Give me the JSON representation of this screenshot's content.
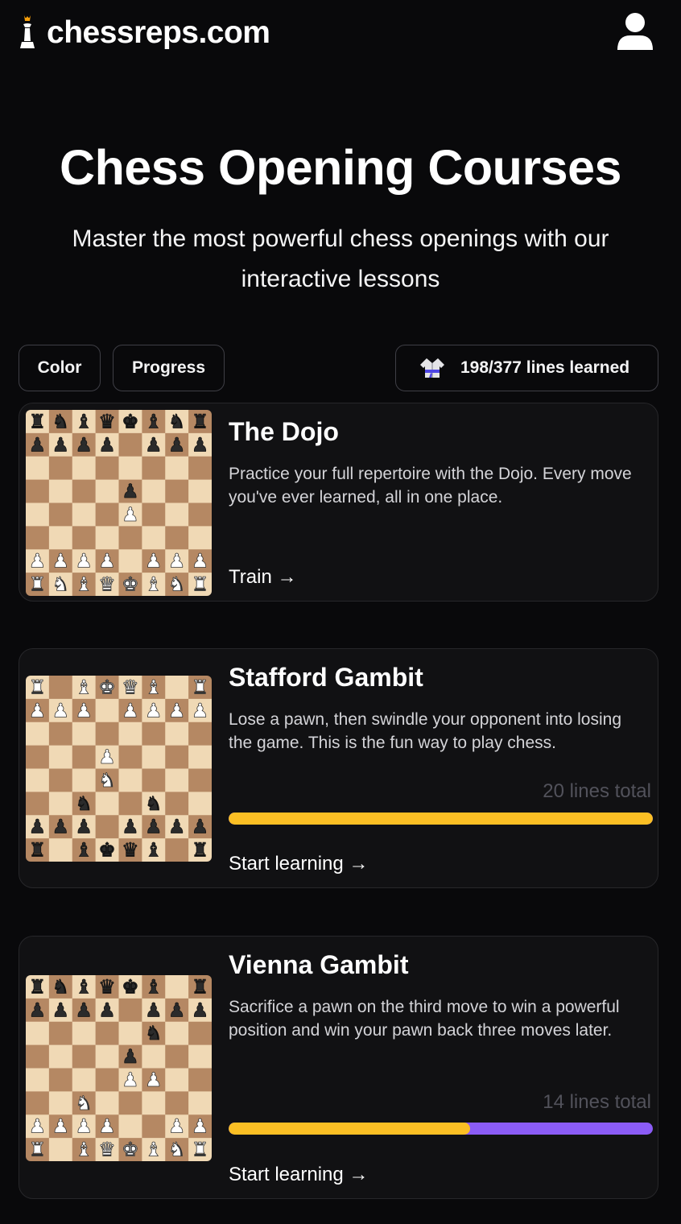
{
  "header": {
    "site_name": "chessreps.com",
    "logo_icon": "chess-king-icon",
    "user_icon": "user-icon"
  },
  "hero": {
    "title": "Chess Opening Courses",
    "subtitle": "Master the most powerful chess openings with our interactive lessons"
  },
  "filters": {
    "color_label": "Color",
    "progress_label": "Progress",
    "stats_icon": "karate-gi-icon",
    "stats_label": "198/377 lines learned"
  },
  "colors": {
    "background": "#09090b",
    "card": "#111113",
    "progress_learned": "#fbbf24",
    "progress_remaining": "#8b5cf6",
    "arrow": "#6d5acf"
  },
  "courses": [
    {
      "title": "The Dojo",
      "description": "Practice your full repertoire with the Dojo. Every move you've ever learned, all in one place.",
      "cta": "Train →",
      "board": [
        "rnbqkbnr",
        "pppp.ppp",
        "........",
        "....p...",
        "....P...",
        "........",
        "PPPP.PPP",
        "RNBQKBNR"
      ]
    },
    {
      "title": "Stafford Gambit",
      "description": "Lose a pawn, then swindle your opponent into losing the game. This is the fun way to play chess.",
      "lines_total": "20 lines total",
      "progress": 1.0,
      "cta": "Start learning →",
      "board": [
        "R.BKQB.R",
        "PPP.PPPP",
        "........",
        "...P....",
        "...N....",
        "..n..n..",
        "ppp.pppp",
        "r.bkqb.r"
      ]
    },
    {
      "title": "Vienna Gambit",
      "description": "Sacrifice a pawn on the third move to win a powerful position and win your pawn back three moves later.",
      "lines_total": "14 lines total",
      "progress": 0.57,
      "cta": "Start learning →",
      "board": [
        "rnbqkb.r",
        "pppp.ppp",
        ".....n..",
        "....p...",
        "....PP..",
        "..N.....",
        "PPPP..PP",
        "R.BQKBNR"
      ]
    }
  ]
}
